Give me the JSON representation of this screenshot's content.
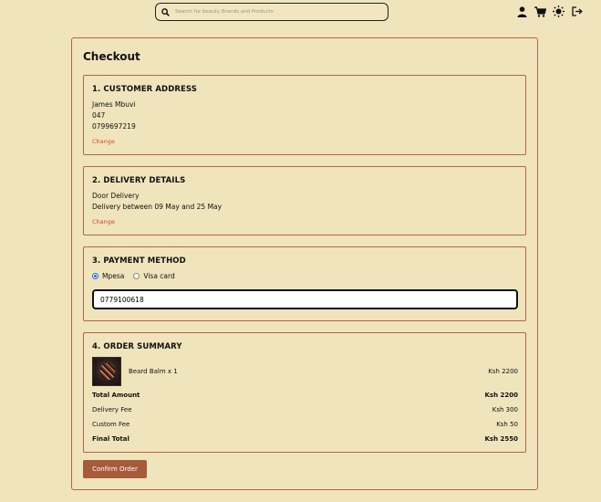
{
  "header": {
    "search_placeholder": "Search for beauty Brands and Products",
    "icons": [
      "user-icon",
      "cart-icon",
      "sun-icon",
      "logout-icon"
    ]
  },
  "checkout": {
    "title": "Checkout",
    "address": {
      "title": "1. CUSTOMER ADDRESS",
      "name": "James Mbuvi",
      "line2": "047",
      "phone": "0799697219",
      "change_label": "Change"
    },
    "delivery": {
      "title": "2. DELIVERY DETAILS",
      "method": "Door Delivery",
      "window": "Delivery between 09 May and 25 May",
      "change_label": "Change"
    },
    "payment": {
      "title": "3. PAYMENT METHOD",
      "options": [
        "Mpesa",
        "Visa card"
      ],
      "selected": "Mpesa",
      "phone_value": "0779100618"
    },
    "summary": {
      "title": "4. ORDER SUMMARY",
      "item_name": "Beard Balm x 1",
      "item_price": "Ksh 2200",
      "total_label": "Total Amount",
      "total_value": "Ksh 2200",
      "delivery_label": "Delivery Fee",
      "delivery_value": "Ksh 300",
      "custom_label": "Custom Fee",
      "custom_value": "Ksh 50",
      "final_label": "Final Total",
      "final_value": "Ksh 2550"
    },
    "confirm_label": "Confirm Order"
  },
  "colors": {
    "background": "#efe4bb",
    "border": "#b4644a",
    "link": "#d9443a",
    "button": "#a85b3a"
  }
}
